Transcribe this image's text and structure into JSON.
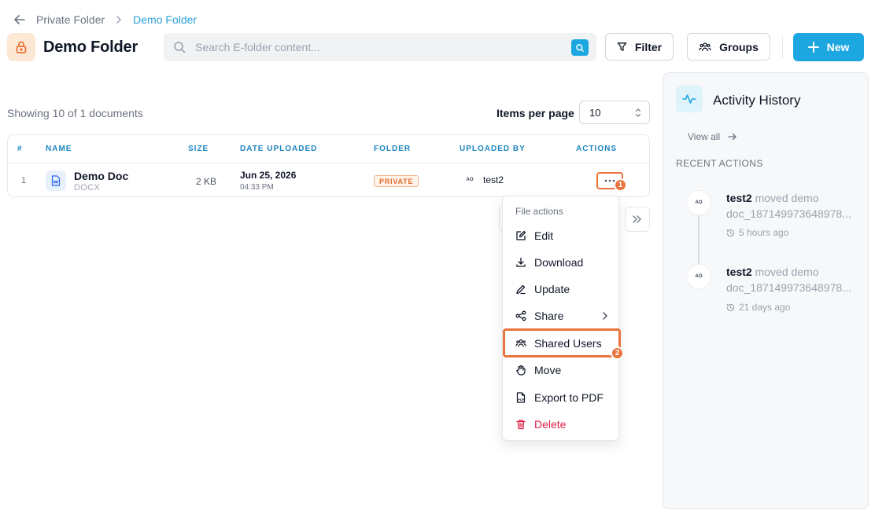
{
  "breadcrumb": {
    "parent": "Private Folder",
    "current": "Demo Folder"
  },
  "header": {
    "title": "Demo Folder",
    "search_placeholder": "Search E-folder content...",
    "filter_label": "Filter",
    "groups_label": "Groups",
    "new_label": "New"
  },
  "list": {
    "showing_text": "Showing 10 of 1 documents",
    "items_per_page_label": "Items per page",
    "items_per_page_value": "10"
  },
  "table": {
    "columns": [
      "#",
      "NAME",
      "SIZE",
      "DATE UPLOADED",
      "FOLDER",
      "UPLOADED BY",
      "ACTIONS"
    ],
    "rows": [
      {
        "index": "1",
        "name": "Demo Doc",
        "type": "DOCX",
        "size": "2 KB",
        "date": "Jun 25, 2026",
        "time": "04:33 PM",
        "folder": "PRIVATE",
        "uploaded_by": "test2",
        "avatar_text": "AO"
      }
    ]
  },
  "annotations": {
    "step1": "1",
    "step2": "2"
  },
  "menu": {
    "title": "File actions",
    "items": [
      {
        "label": "Edit",
        "icon": "edit-icon"
      },
      {
        "label": "Download",
        "icon": "download-icon"
      },
      {
        "label": "Update",
        "icon": "pencil-icon"
      },
      {
        "label": "Share",
        "icon": "share-icon"
      },
      {
        "label": "Shared Users",
        "icon": "users-icon"
      },
      {
        "label": "Move",
        "icon": "hand-icon"
      },
      {
        "label": "Export to PDF",
        "icon": "pdf-icon"
      },
      {
        "label": "Delete",
        "icon": "trash-icon"
      }
    ]
  },
  "activity": {
    "title": "Activity History",
    "view_all": "View all",
    "recent_label": "RECENT ACTIONS",
    "items": [
      {
        "user": "test2",
        "action": "moved demo",
        "detail": "doc_187149973648978...",
        "time": "5 hours ago",
        "avatar_text": "AO"
      },
      {
        "user": "test2",
        "action": "moved demo",
        "detail": "doc_187149973648978...",
        "time": "21 days ago",
        "avatar_text": "AO"
      }
    ]
  },
  "colors": {
    "accent": "#1ca7e0",
    "annotation": "#e8743b",
    "danger": "#e11d48",
    "private_badge": "#e06b2b"
  }
}
